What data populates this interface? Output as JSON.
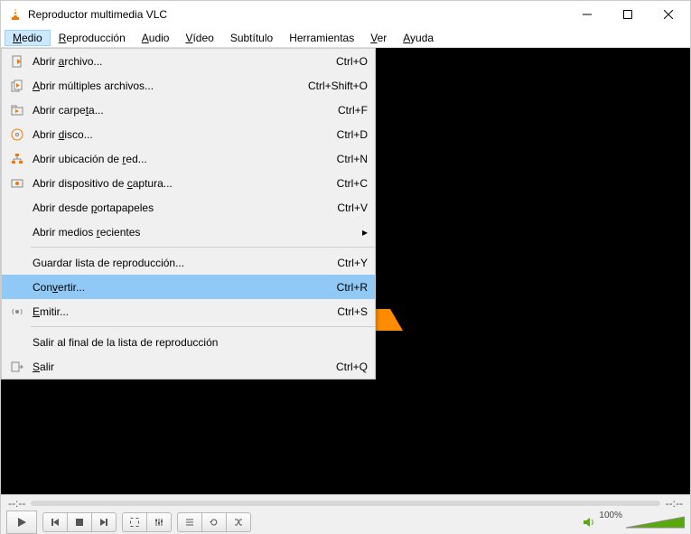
{
  "title": "Reproductor multimedia VLC",
  "menubar": [
    {
      "label": "Medio",
      "u": "M",
      "rest": "edio"
    },
    {
      "label": "Reproducción",
      "u": "R",
      "rest": "eproducción"
    },
    {
      "label": "Audio",
      "u": "A",
      "rest": "udio"
    },
    {
      "label": "Vídeo",
      "u": "V",
      "rest": "ídeo"
    },
    {
      "label": "Subtítulo",
      "u": "",
      "rest": "Subtítulo"
    },
    {
      "label": "Herramientas",
      "u": "",
      "rest": "Herramientas"
    },
    {
      "label": "Ver",
      "u": "V",
      "rest": "er"
    },
    {
      "label": "Ayuda",
      "u": "A",
      "rest": "yuda"
    }
  ],
  "dropdown": {
    "items": [
      {
        "icon": "file",
        "pre": "Abrir ",
        "u": "a",
        "post": "rchivo...",
        "shortcut": "Ctrl+O"
      },
      {
        "icon": "multi",
        "pre": "",
        "u": "A",
        "post": "brir múltiples archivos...",
        "shortcut": "Ctrl+Shift+O"
      },
      {
        "icon": "folder",
        "pre": "Abrir carpe",
        "u": "t",
        "post": "a...",
        "shortcut": "Ctrl+F"
      },
      {
        "icon": "disc",
        "pre": "Abrir ",
        "u": "d",
        "post": "isco...",
        "shortcut": "Ctrl+D"
      },
      {
        "icon": "net",
        "pre": "Abrir ubicación de ",
        "u": "r",
        "post": "ed...",
        "shortcut": "Ctrl+N"
      },
      {
        "icon": "capture",
        "pre": "Abrir dispositivo de ",
        "u": "c",
        "post": "aptura...",
        "shortcut": "Ctrl+C"
      },
      {
        "icon": "",
        "pre": "Abrir desde ",
        "u": "p",
        "post": "ortapapeles",
        "shortcut": "Ctrl+V"
      },
      {
        "icon": "",
        "pre": "Abrir medios ",
        "u": "r",
        "post": "ecientes",
        "shortcut": "",
        "submenu": true
      }
    ],
    "group2": [
      {
        "icon": "",
        "pre": "Guardar lista de reproducción...",
        "u": "",
        "post": "",
        "shortcut": "Ctrl+Y"
      },
      {
        "icon": "",
        "pre": "Con",
        "u": "v",
        "post": "ertir...",
        "shortcut": "Ctrl+R",
        "hover": true
      },
      {
        "icon": "stream",
        "pre": "",
        "u": "E",
        "post": "mitir...",
        "shortcut": "Ctrl+S"
      }
    ],
    "group3": [
      {
        "icon": "",
        "pre": "Salir al final de la lista de reproducción",
        "u": "",
        "post": "",
        "shortcut": ""
      },
      {
        "icon": "quit",
        "pre": "",
        "u": "S",
        "post": "alir",
        "shortcut": "Ctrl+Q"
      }
    ]
  },
  "time_left": "--:--",
  "time_right": "--:--",
  "volume": "100%"
}
